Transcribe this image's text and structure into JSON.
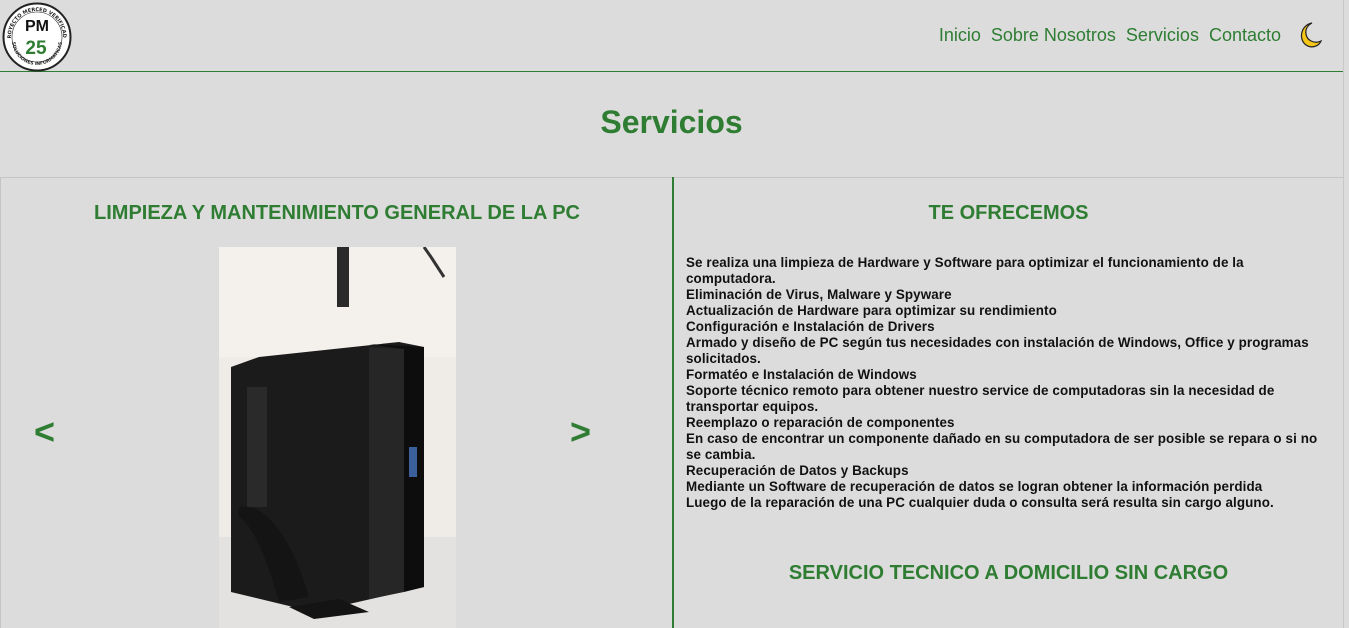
{
  "logo": {
    "top": "PM",
    "number": "25",
    "ring_top": "PROYECTO MERCED VERIFICADO",
    "ring_bottom": "SOLUCIONES INFORMATICAS"
  },
  "nav": {
    "items": [
      "Inicio",
      "Sobre Nosotros",
      "Servicios",
      "Contacto"
    ],
    "theme_toggle_icon": "moon-icon"
  },
  "page": {
    "title": "Servicios"
  },
  "left_panel": {
    "heading": "LIMPIEZA Y MANTENIMIENTO GENERAL DE LA PC",
    "prev": "<",
    "next": ">",
    "image_icon": "pc-tower-photo"
  },
  "right_panel": {
    "heading": "TE OFRECEMOS",
    "services": [
      "Se realiza una limpieza de Hardware y Software para optimizar el funcionamiento de la computadora.",
      "Eliminación de Virus, Malware y Spyware",
      "Actualización de Hardware para optimizar su rendimiento",
      "Configuración e Instalación de Drivers",
      "Armado y diseño de PC según tus necesidades con instalación de Windows, Office y programas solicitados.",
      "Formatéo e Instalación de Windows",
      "Soporte técnico remoto para obtener nuestro service de computadoras sin la necesidad de transportar equipos.",
      "Reemplazo o reparación de componentes",
      "En caso de encontrar un componente dañado en su computadora de ser posible se repara o si no se cambia.",
      "Recuperación de Datos y Backups",
      "Mediante un Software de recuperación de datos se logran obtener la información perdida",
      "Luego de la reparación de una PC cualquier duda o consulta será resulta sin cargo alguno."
    ],
    "bottom_heading": "SERVICIO TECNICO A DOMICILIO SIN CARGO"
  },
  "colors": {
    "accent": "#2e7d32",
    "background": "#dcdcdc"
  }
}
